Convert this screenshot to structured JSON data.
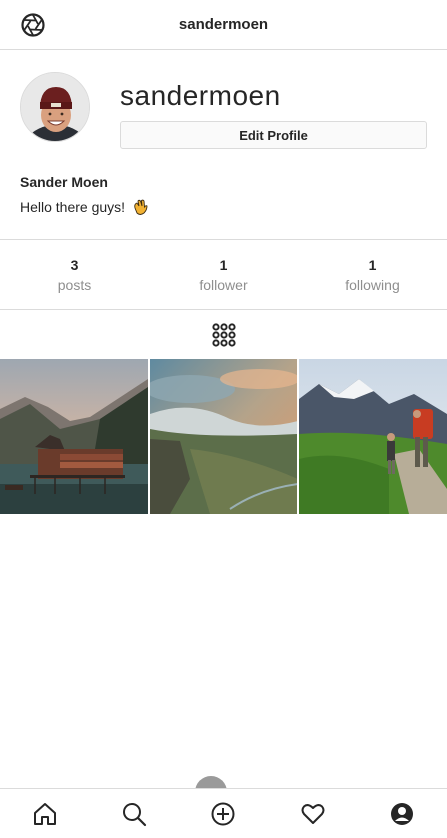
{
  "header": {
    "title": "sandermoen",
    "logo_icon": "camera-aperture-icon"
  },
  "profile": {
    "username": "sandermoen",
    "edit_button_label": "Edit Profile",
    "full_name": "Sander Moen",
    "bio": "Hello there guys!",
    "bio_emoji_icon": "waving-hand-icon"
  },
  "stats": [
    {
      "value": "3",
      "label": "posts"
    },
    {
      "value": "1",
      "label": "follower"
    },
    {
      "value": "1",
      "label": "following"
    }
  ],
  "view_toggle": {
    "icon": "grid-icon"
  },
  "posts": [
    {
      "icon": "photo-lake-cabin"
    },
    {
      "icon": "photo-mountain-valley"
    },
    {
      "icon": "photo-hikers-trail"
    }
  ],
  "bottom_nav": [
    {
      "icon": "home-icon"
    },
    {
      "icon": "search-icon"
    },
    {
      "icon": "add-post-icon"
    },
    {
      "icon": "heart-icon"
    },
    {
      "icon": "profile-icon"
    }
  ],
  "colors": {
    "text": "#262626",
    "muted": "#8e8e8e",
    "border": "#dbdbdb"
  }
}
